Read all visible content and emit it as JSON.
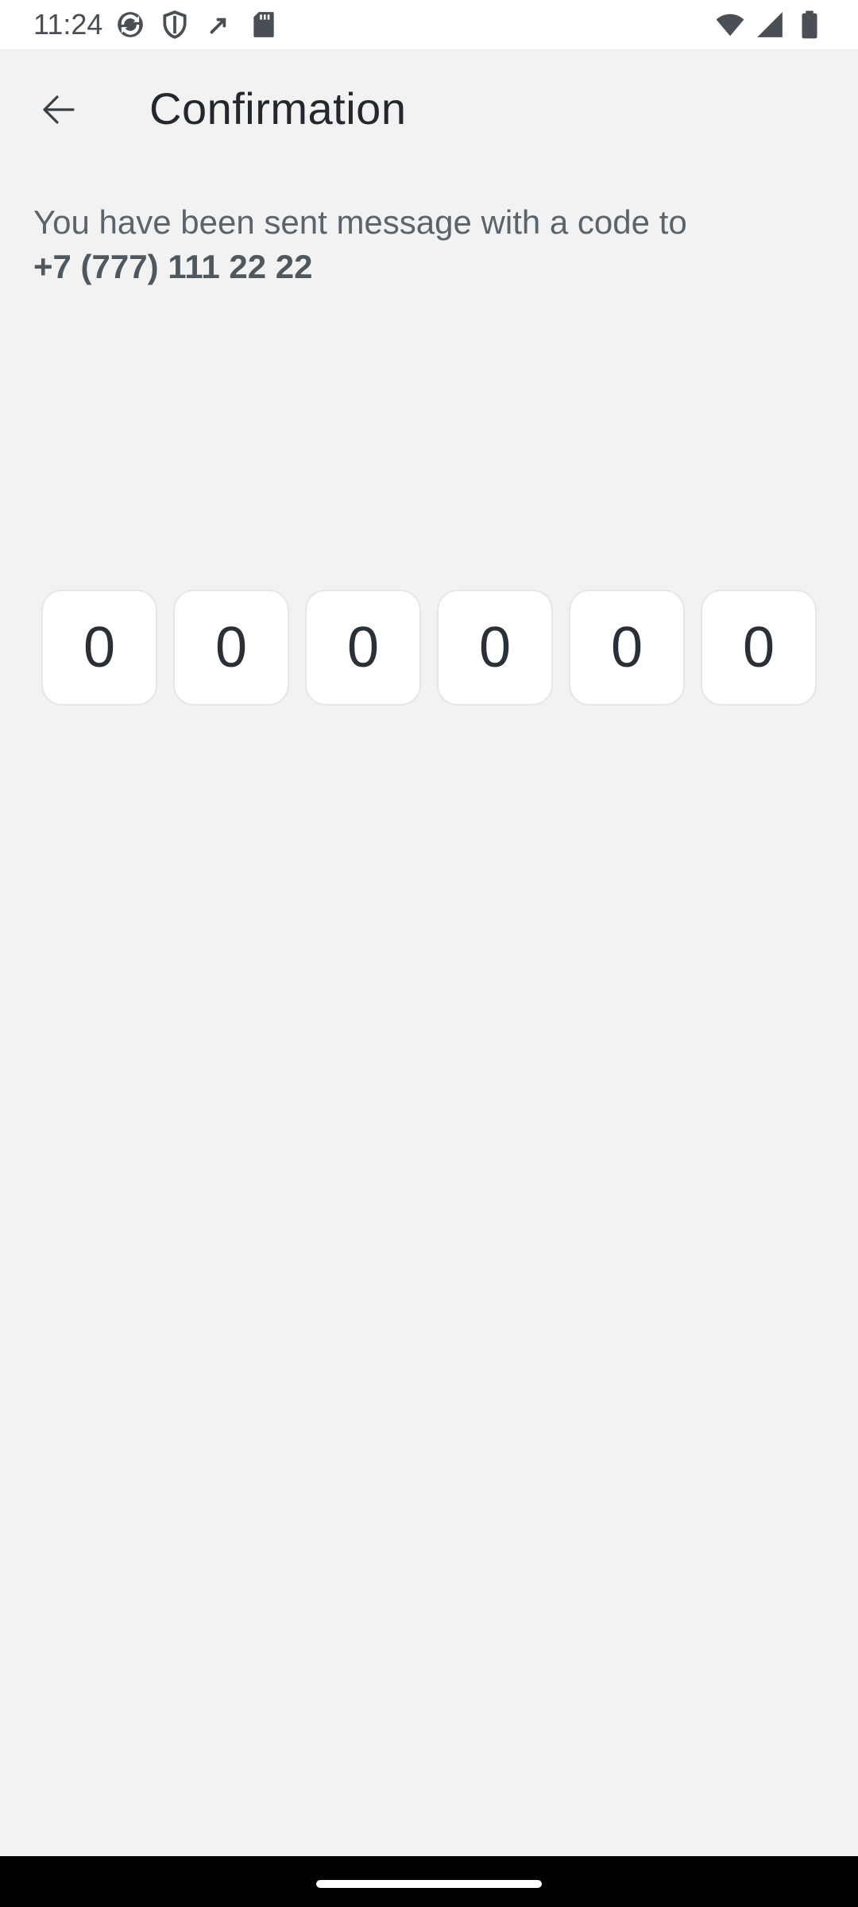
{
  "status_bar": {
    "time": "11:24",
    "left_icons": [
      "sync-icon",
      "shield-icon",
      "call-forward-icon",
      "sd-card-icon"
    ],
    "right_icons": [
      "wifi-icon",
      "signal-icon",
      "battery-icon"
    ]
  },
  "app_bar": {
    "back_icon": "arrow-back-icon",
    "title": "Confirmation"
  },
  "message": {
    "text": "You have been sent message with a code to",
    "phone": "+7 (777) 111 22 22"
  },
  "code": {
    "digits": [
      "0",
      "0",
      "0",
      "0",
      "0",
      "0"
    ]
  },
  "colors": {
    "background": "#f2f2f2",
    "title": "#23282e",
    "body_text": "#5b636b",
    "box_background": "#ffffff"
  }
}
